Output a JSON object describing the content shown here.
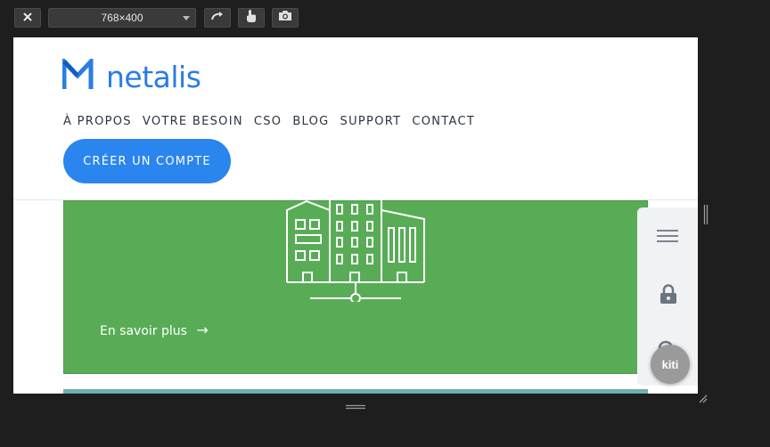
{
  "toolbar": {
    "close_icon": "close-icon",
    "size_value": "768×400",
    "rotate_icon": "rotate-icon",
    "touch_icon": "touch-icon",
    "screenshot_icon": "camera-icon"
  },
  "site": {
    "logo_text": "netalis",
    "brand_color": "#2a7de1",
    "nav": [
      "À PROPOS",
      "VOTRE BESOIN",
      "CSO",
      "BLOG",
      "SUPPORT",
      "CONTACT"
    ],
    "cta_label": "CRÉER UN COMPTE",
    "cta_color": "#2a85ee",
    "card": {
      "color": "#58ac56",
      "link_label": "En savoir plus",
      "link_arrow": "→"
    }
  },
  "widget": {
    "icons": [
      "menu-icon",
      "lock-icon",
      "search-icon"
    ],
    "kiti_label": "kiti"
  }
}
